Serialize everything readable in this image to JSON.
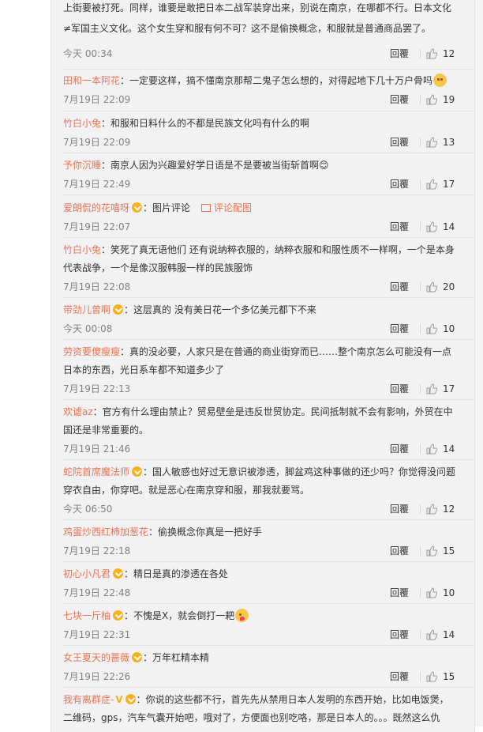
{
  "reply_label": "回覆",
  "comments": [
    {
      "id": "c0",
      "user": "",
      "text": "上街要被打死。同样，谁要是敢把日本二战军装穿出来，别说在南京，在哪都不行。日本文化≠军国主义文化。这个女生穿和服有何不可？这不是偷换概念，和服就是普通商品罢了。",
      "time": "今天 00:34",
      "likes": "12"
    },
    {
      "id": "c1",
      "user": "田和一本阿花",
      "text": "：一定要这样，搞不懂南京那帮二鬼子怎么想的，对得起地下几十万户骨吗",
      "time": "7月19日 22:09",
      "likes": "19"
    },
    {
      "id": "c2",
      "user": "竹白小兔",
      "text": "：和服和日料什么的不都是民族文化吗有什么的啊",
      "time": "7月19日 22:09",
      "likes": "13"
    },
    {
      "id": "c3",
      "user": "予你沉睡",
      "text": "：南京人因为兴趣爱好学日语是不是要被当街斩首啊😊",
      "time": "7月19日 22:49",
      "likes": "17"
    },
    {
      "id": "c4",
      "user": "爱朗侃的花嘻呀",
      "text": "：图片评论",
      "pic_link": "评论配图",
      "time": "7月19日 22:07",
      "likes": "14"
    },
    {
      "id": "c5",
      "user": "竹白小兔",
      "text": "：笑死了真无语他们 还有说纳粹衣服的，纳粹衣服和和服性质不一样啊，一个是本身代表战争，一个是像汉服韩服一样的民族服饰",
      "time": "7月19日 22:08",
      "likes": "20"
    },
    {
      "id": "c6",
      "user": "带劲儿曾啊",
      "text": "：这层真的 没有美日花一个多亿美元都下不来",
      "time": "今天 00:08",
      "likes": "10"
    },
    {
      "id": "c7",
      "user": "劳资要傻瘦瘦",
      "text": "：真的没必要，人家只是在普通的商业街穿而已……整个南京怎么可能没有一点日本的东西，光日系车都不知道多少了",
      "time": "7月19日 22:13",
      "likes": "17"
    },
    {
      "id": "c8",
      "user": "欢谑az",
      "text": "：官方有什么理由禁止？贸易壁垒是违反世贸协定。民间抵制就不会有影响，外贸在中国还是非常重要的。",
      "time": "7月19日 21:46",
      "likes": "14"
    },
    {
      "id": "c9",
      "user": "蛇院首席魔法师",
      "text": "：国人敏感也好过无意识被渗透，脚盆鸡这种事做的还少吗？你觉得没问题穿衣自由，你穿吧。就是恶心在南京穿和服，那我就要骂。",
      "time": "今天 06:50",
      "likes": "12"
    },
    {
      "id": "c10",
      "user": "鸡蛋炒西红柿加葱花",
      "text": "：偷换概念你真是一把好手",
      "time": "7月19日 22:18",
      "likes": "15"
    },
    {
      "id": "c11",
      "user": "初心小凡君",
      "text": "：精日是真的渗透在各处",
      "time": "7月19日 22:48",
      "likes": "10"
    },
    {
      "id": "c12",
      "user": "七块一斤柚",
      "text": "：不愧是X，就会倒打一耙",
      "time": "7月19日 22:31",
      "likes": "14"
    },
    {
      "id": "c13",
      "user": "女王夏天的蔷薇",
      "text": "：万年杠精本精",
      "time": "7月19日 22:26",
      "likes": "15"
    },
    {
      "id": "c14",
      "user": "我有离群症-",
      "badge": "V",
      "text": "：你说的这些都不行，首先先从禁用日本人发明的东西开始，比如电饭煲，二维码，gps，汽车气囊开始吧，哦对了，方便面也别吃咯，那是日本人的。。。既然这么仇",
      "time": "",
      "likes": ""
    }
  ]
}
